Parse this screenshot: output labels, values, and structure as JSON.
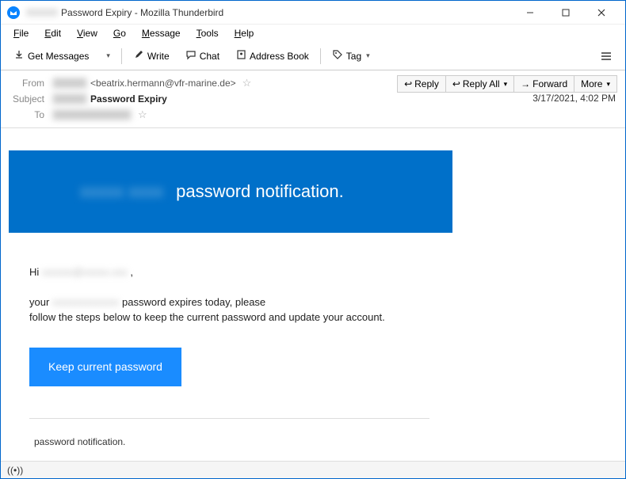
{
  "titlebar": {
    "redacted_prefix": "XXXXX",
    "title": "Password Expiry - Mozilla Thunderbird"
  },
  "menubar": {
    "items": [
      "File",
      "Edit",
      "View",
      "Go",
      "Message",
      "Tools",
      "Help"
    ]
  },
  "toolbar": {
    "get_messages": "Get Messages",
    "write": "Write",
    "chat": "Chat",
    "address_book": "Address Book",
    "tag": "Tag"
  },
  "header": {
    "from_label": "From",
    "subject_label": "Subject",
    "to_label": "To",
    "from_redacted": "XXXXX",
    "from_email": "<beatrix.hermann@vfr-marine.de>",
    "subject_redacted": "XXXXX",
    "subject_text": "Password Expiry",
    "to_redacted": "XXXXXXXXXXXX",
    "datetime": "3/17/2021, 4:02 PM",
    "actions": {
      "reply": "Reply",
      "reply_all": "Reply All",
      "forward": "Forward",
      "more": "More"
    }
  },
  "email": {
    "banner_redacted": "xxxxx xxxx",
    "banner_text": "password notification.",
    "greeting_prefix": "Hi ",
    "greeting_redacted": "xxxxxx@xxxxx.xxx",
    "greeting_suffix": " ,",
    "line2_prefix": "your ",
    "line2_redacted": "xxxxxxxxxxxxx",
    "line2_suffix": " password expires today, please",
    "line3": "follow the steps below to keep the current password and update your account.",
    "button": "Keep current password",
    "footer": "password notification."
  }
}
